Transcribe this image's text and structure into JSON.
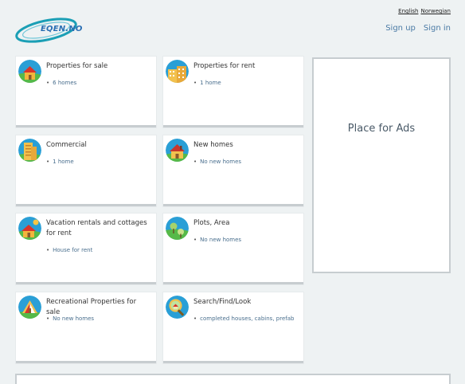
{
  "brand": {
    "logo_text": "EQEN.NO"
  },
  "language": {
    "english": "English",
    "norwegian": "Norwegian"
  },
  "auth": {
    "signup": "Sign up",
    "signin": "Sign in"
  },
  "cards": [
    {
      "title": "Properties for sale",
      "sub": "6 homes",
      "icon": "house-for-sale-icon"
    },
    {
      "title": "Properties for rent",
      "sub": "1 home",
      "icon": "apartment-building-icon"
    },
    {
      "title": "Commercial",
      "sub": "1 home",
      "icon": "office-building-icon"
    },
    {
      "title": "New homes",
      "sub": "No new homes",
      "icon": "new-house-icon"
    },
    {
      "title": "Vacation rentals and cottages for rent",
      "sub": "House for rent",
      "icon": "cottage-icon"
    },
    {
      "title": "Plots, Area",
      "sub": "No new homes",
      "icon": "trees-plot-icon"
    },
    {
      "title": "Recreational Properties for sale",
      "sub": "No new homes",
      "icon": "tent-icon"
    },
    {
      "title": "Search/Find/Look",
      "sub": "completed houses, cabins, prefab",
      "icon": "magnifier-search-icon"
    }
  ],
  "ads": {
    "label": "Place for Ads"
  },
  "colors": {
    "accent": "#4a7aa5",
    "card_border": "#c7cdd0",
    "background": "#eef2f3"
  }
}
